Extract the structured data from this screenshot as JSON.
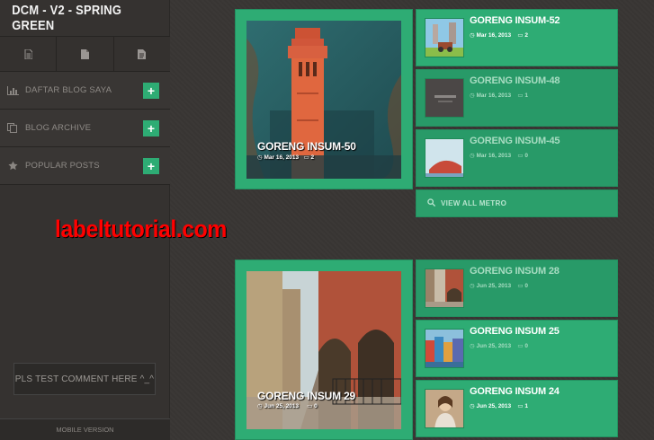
{
  "sidebar": {
    "brand": "DCM - V2 - SPRING GREEN",
    "icon_row": [
      "document-list-icon",
      "document-icon",
      "document-text-icon"
    ],
    "menu": [
      {
        "label": "DAFTAR BLOG SAYA",
        "icon": "bar-chart-icon",
        "action": "+"
      },
      {
        "label": "BLOG ARCHIVE",
        "icon": "copy-icon",
        "action": "+"
      },
      {
        "label": "POPULAR POSTS",
        "icon": "star-icon",
        "action": "+"
      }
    ],
    "comment_box": "PLS TEST COMMENT HERE ^_^",
    "mobile_label": "MOBILE VERSION"
  },
  "watermark": "labeltutorial.com",
  "section1": {
    "feature": {
      "title": "GORENG INSUM-50",
      "date": "Mar 16, 2013",
      "comments": "2"
    },
    "items": [
      {
        "title": "GORENG INSUM-52",
        "date": "Mar 16, 2013",
        "comments": "2"
      },
      {
        "title": "GORENG INSUM-48",
        "date": "Mar 16, 2013",
        "comments": "1"
      },
      {
        "title": "GORENG INSUM-45",
        "date": "Mar 16, 2013",
        "comments": "0"
      }
    ],
    "view_all": "VIEW ALL METRO"
  },
  "section2": {
    "feature": {
      "title": "GORENG INSUM 29",
      "date": "Jun 25, 2013",
      "comments": "0"
    },
    "items": [
      {
        "title": "GORENG INSUM 28",
        "date": "Jun 25, 2013",
        "comments": "0"
      },
      {
        "title": "GORENG INSUM 25",
        "date": "Jun 25, 2013",
        "comments": "0"
      },
      {
        "title": "GORENG INSUM 24",
        "date": "Jun 25, 2013",
        "comments": "1"
      }
    ]
  },
  "colors": {
    "accent": "#2eac74",
    "watermark": "#ff0000",
    "sidebar": "#353230"
  }
}
